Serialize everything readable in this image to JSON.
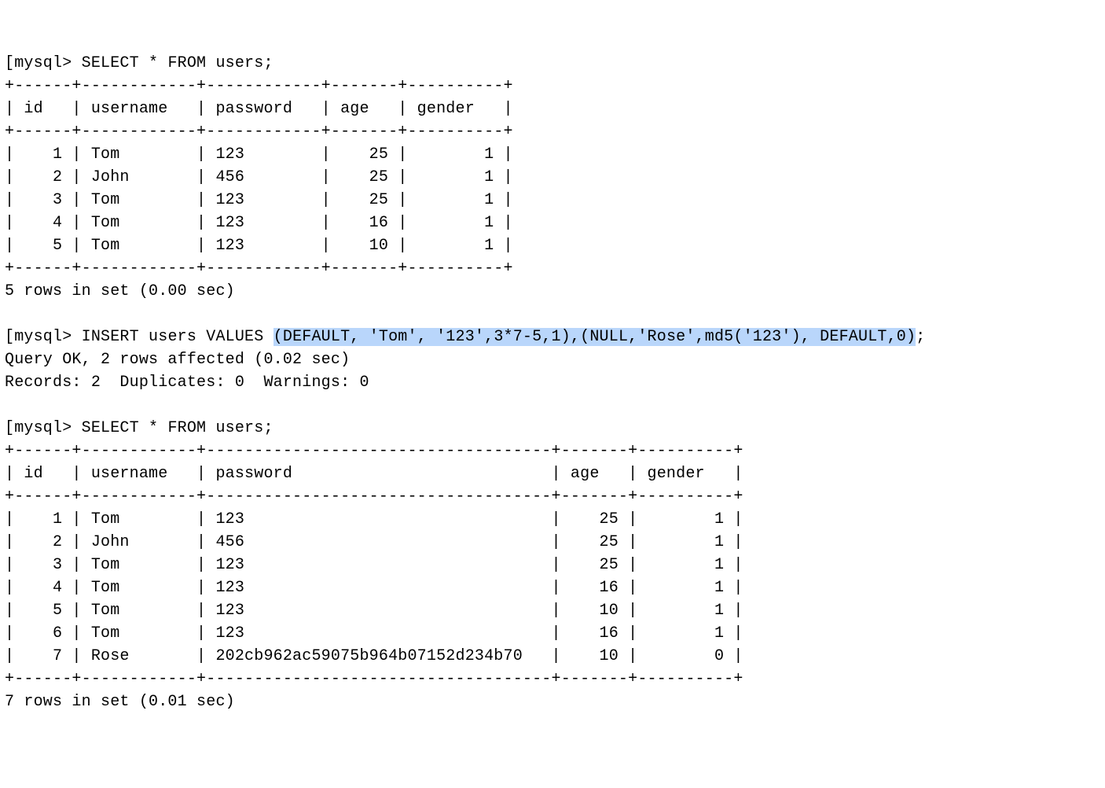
{
  "block1": {
    "prompt": "mysql> ",
    "query": "SELECT * FROM users;",
    "columns": [
      "id",
      "username",
      "password",
      "age",
      "gender"
    ],
    "widths": [
      4,
      10,
      10,
      5,
      8
    ],
    "rows": [
      {
        "id": "1",
        "username": "Tom",
        "password": "123",
        "age": "25",
        "gender": "1"
      },
      {
        "id": "2",
        "username": "John",
        "password": "456",
        "age": "25",
        "gender": "1"
      },
      {
        "id": "3",
        "username": "Tom",
        "password": "123",
        "age": "25",
        "gender": "1"
      },
      {
        "id": "4",
        "username": "Tom",
        "password": "123",
        "age": "16",
        "gender": "1"
      },
      {
        "id": "5",
        "username": "Tom",
        "password": "123",
        "age": "10",
        "gender": "1"
      }
    ],
    "footer": "5 rows in set (0.00 sec)"
  },
  "insert_block": {
    "prompt": "mysql> ",
    "pre": "INSERT users VALUES ",
    "highlight": "(DEFAULT, 'Tom', '123',3*7-5,1),(NULL,'Rose',md5('123'), DEFAULT,0)",
    "post": ";",
    "response1": "Query OK, 2 rows affected (0.02 sec)",
    "response2": "Records: 2  Duplicates: 0  Warnings: 0"
  },
  "block2": {
    "prompt": "mysql> ",
    "query": "SELECT * FROM users;",
    "columns": [
      "id",
      "username",
      "password",
      "age",
      "gender"
    ],
    "widths": [
      4,
      10,
      34,
      5,
      8
    ],
    "rows": [
      {
        "id": "1",
        "username": "Tom",
        "password": "123",
        "age": "25",
        "gender": "1"
      },
      {
        "id": "2",
        "username": "John",
        "password": "456",
        "age": "25",
        "gender": "1"
      },
      {
        "id": "3",
        "username": "Tom",
        "password": "123",
        "age": "25",
        "gender": "1"
      },
      {
        "id": "4",
        "username": "Tom",
        "password": "123",
        "age": "16",
        "gender": "1"
      },
      {
        "id": "5",
        "username": "Tom",
        "password": "123",
        "age": "10",
        "gender": "1"
      },
      {
        "id": "6",
        "username": "Tom",
        "password": "123",
        "age": "16",
        "gender": "1"
      },
      {
        "id": "7",
        "username": "Rose",
        "password": "202cb962ac59075b964b07152d234b70",
        "age": "10",
        "gender": "0"
      }
    ],
    "footer": "7 rows in set (0.01 sec)"
  },
  "align": {
    "id": "right",
    "username": "left",
    "password": "left",
    "age": "right",
    "gender": "right"
  }
}
